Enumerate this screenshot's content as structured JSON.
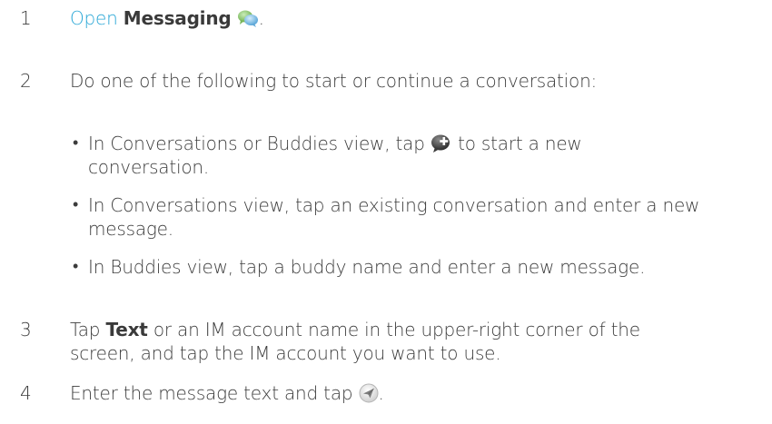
{
  "steps": [
    {
      "number": "1",
      "link_text": "Open",
      "app_name": "Messaging",
      "icon": "messaging-icon",
      "end": "."
    },
    {
      "number": "2",
      "text": "Do one of the following to start or continue a conversation:",
      "bullets": [
        {
          "marker": "•",
          "line1_before": "In Conversations or Buddies view, tap",
          "icon": "new-conversation-icon",
          "line1_after": "to start a new",
          "line2": "conversation."
        },
        {
          "marker": "•",
          "line1": "In Conversations view, tap an existing conversation and enter a new",
          "line2": "message."
        },
        {
          "marker": "•",
          "line1": "In Buddies view, tap a buddy name and enter a new message."
        }
      ]
    },
    {
      "number": "3",
      "bold_word": "Text",
      "line1_rest": "or an IM account name in the upper-right corner of the",
      "line1_start": "Tap",
      "line2": "screen, and tap the IM account you want to use."
    },
    {
      "number": "4",
      "text_before": "Enter the message text and tap",
      "icon": "send-icon",
      "end": "."
    }
  ],
  "colors": {
    "text": "#3c3c3c",
    "link": "#2aa7d6"
  }
}
